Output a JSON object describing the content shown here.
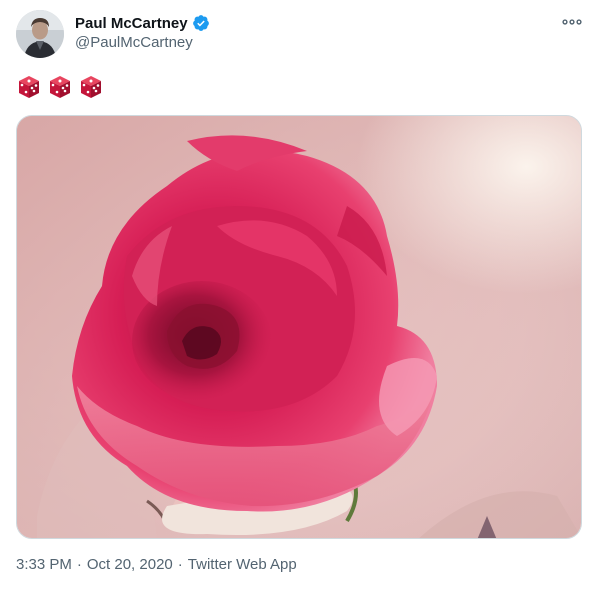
{
  "author": {
    "display_name": "Paul McCartney",
    "handle": "@PaulMcCartney",
    "verified": true
  },
  "tweet": {
    "emoji_text": [
      "dice",
      "dice",
      "dice"
    ],
    "media_description_icon": "rose-photo"
  },
  "meta": {
    "time": "3:33 PM",
    "date": "Oct 20, 2020",
    "source": "Twitter Web App",
    "separator": "·"
  },
  "icons": {
    "verified": "verified-badge-icon",
    "more": "more-options-icon",
    "emoji": "game-die-icon"
  },
  "colors": {
    "verified": "#1d9bf0",
    "secondary_text": "#536471",
    "primary_text": "#0f1419",
    "dice": "#c4163b"
  }
}
